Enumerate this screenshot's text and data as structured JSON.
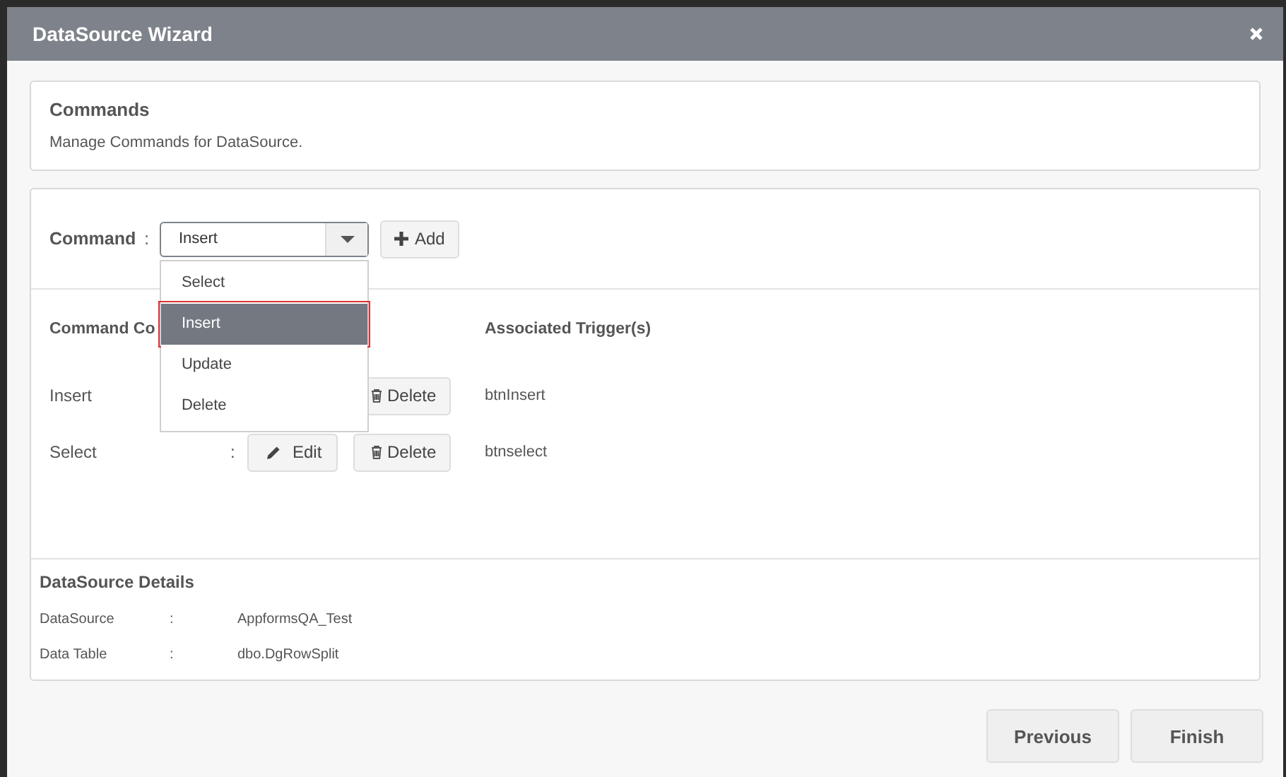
{
  "window": {
    "title": "DataSource Wizard"
  },
  "intro": {
    "title": "Commands",
    "description": "Manage Commands for DataSource."
  },
  "command": {
    "label": "Command",
    "separator": ":",
    "value": "Insert",
    "add_label": "Add",
    "expanded": true,
    "options": [
      {
        "label": "Select",
        "selected": false
      },
      {
        "label": "Insert",
        "selected": true
      },
      {
        "label": "Update",
        "selected": false
      },
      {
        "label": "Delete",
        "selected": false
      }
    ]
  },
  "table": {
    "columns": [
      "Command Co",
      "Associated Trigger(s)"
    ],
    "rows": [
      {
        "name": "Insert",
        "delete_label": "Delete",
        "trigger": "btnInsert"
      },
      {
        "name": "Select",
        "separator": ":",
        "edit_label": "Edit",
        "delete_label": "Delete",
        "trigger": "btnselect"
      }
    ]
  },
  "details": {
    "title": "DataSource Details",
    "rows": [
      {
        "label": "DataSource",
        "separator": ":",
        "value": "AppformsQA_Test"
      },
      {
        "label": "Data Table",
        "separator": ":",
        "value": "dbo.DgRowSplit"
      }
    ]
  },
  "buttons": [
    "Previous",
    "Finish"
  ]
}
